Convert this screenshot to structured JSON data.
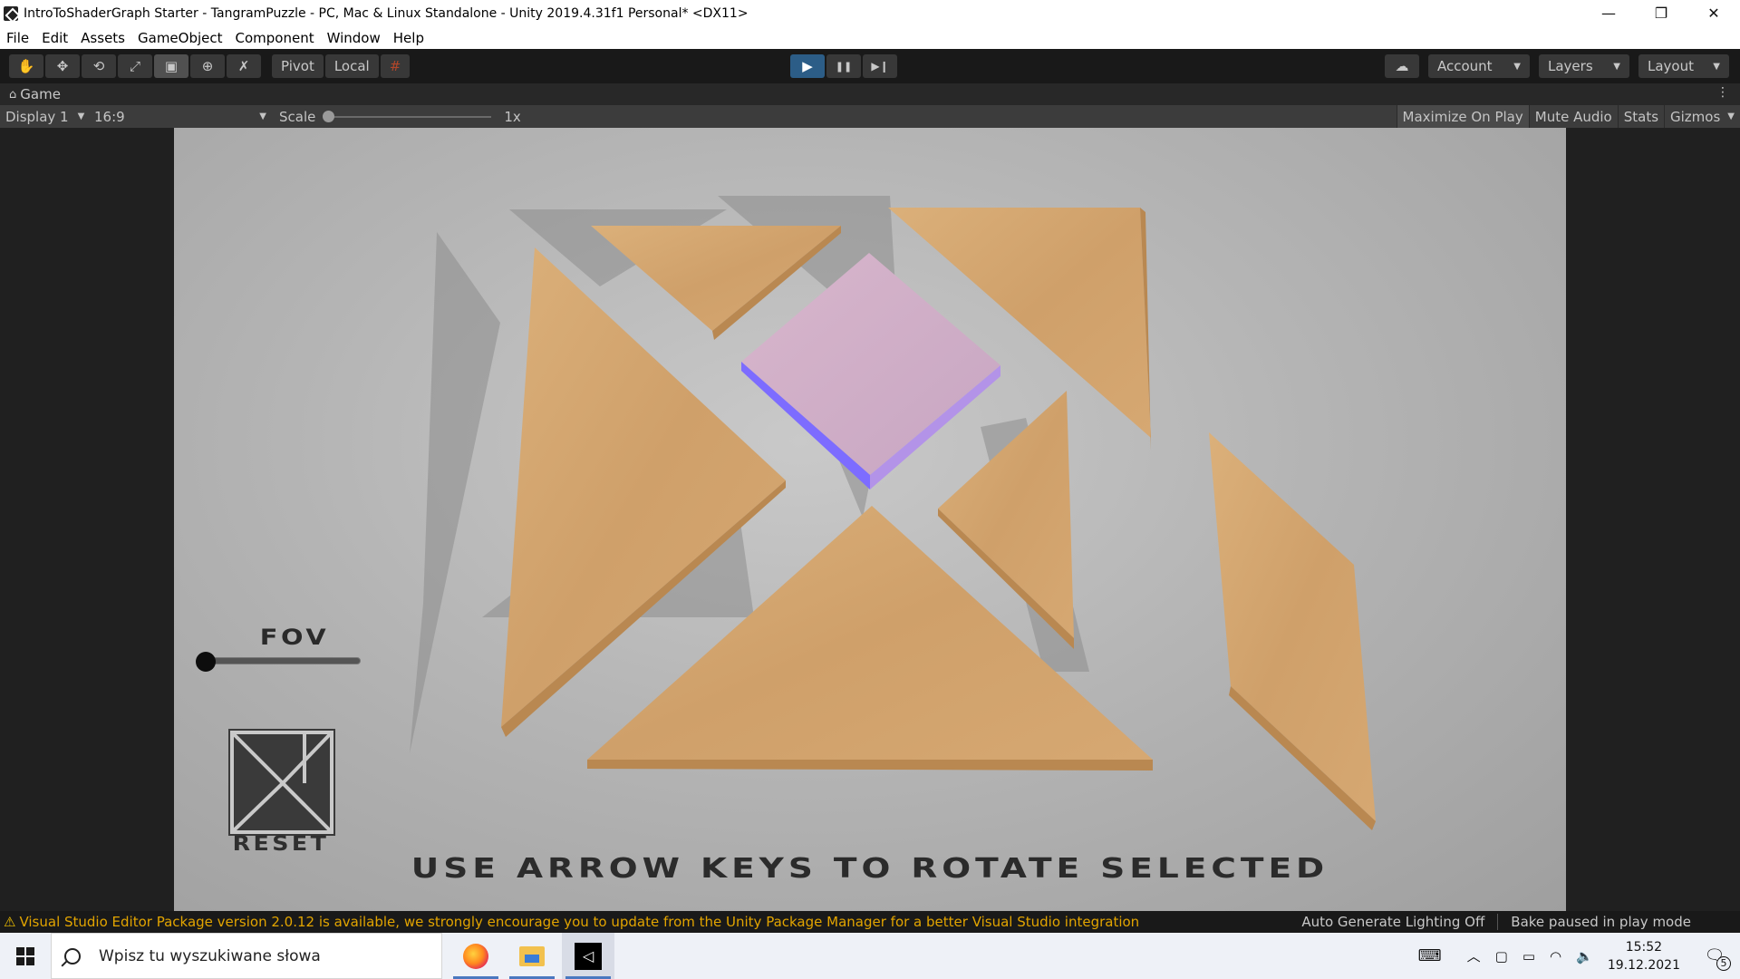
{
  "window": {
    "title": "IntroToShaderGraph Starter - TangramPuzzle - PC, Mac & Linux Standalone - Unity 2019.4.31f1 Personal* <DX11>",
    "controls": {
      "minimize": "—",
      "restore": "❐",
      "close": "✕"
    }
  },
  "menu": {
    "items": [
      "File",
      "Edit",
      "Assets",
      "GameObject",
      "Component",
      "Window",
      "Help"
    ]
  },
  "toolbar": {
    "tools": [
      {
        "name": "hand-tool",
        "glyph": "✋"
      },
      {
        "name": "move-tool",
        "glyph": "✥"
      },
      {
        "name": "rotate-tool",
        "glyph": "⟲"
      },
      {
        "name": "scale-tool",
        "glyph": "⤢"
      },
      {
        "name": "rect-tool",
        "glyph": "▣"
      },
      {
        "name": "transform-tool",
        "glyph": "⊕"
      },
      {
        "name": "custom-tool",
        "glyph": "✗"
      }
    ],
    "pivot_label": "Pivot",
    "local_label": "Local",
    "grid_snap_glyph": "#",
    "play_glyph": "▶",
    "pause_glyph": "❚❚",
    "step_glyph": "▶❙",
    "account_label": "Account",
    "layers_label": "Layers",
    "layout_label": "Layout",
    "cloud_glyph": "☁",
    "caret": "▼"
  },
  "tab": {
    "label": "Game",
    "icon": "gamepad-icon",
    "kebab": "⋮"
  },
  "gamebar": {
    "display_label": "Display 1",
    "aspect_label": "16:9",
    "scale_label": "Scale",
    "scale_value": "1x",
    "scale_slider": 0.0,
    "buttons": [
      "Maximize On Play",
      "Mute Audio",
      "Stats",
      "Gizmos"
    ],
    "gizmos_caret": "▼"
  },
  "game": {
    "fov_label": "FOV",
    "fov_value": 0.0,
    "reset_label": "RESET",
    "hint": "USE ARROW KEYS TO ROTATE SELECTED",
    "selected_color": "#c8a0c8",
    "wood_color": "#d2a46a"
  },
  "status": {
    "warning": "Visual Studio Editor Package version 2.0.12 is available, we strongly encourage you to update from the Unity Package Manager for a better Visual Studio integration",
    "lighting": "Auto Generate Lighting Off",
    "bake": "Bake paused in play mode",
    "warning_color": "#e2a400"
  },
  "taskbar": {
    "search_placeholder": "Wpisz tu wyszukiwane słowa",
    "time": "15:52",
    "date": "19.12.2021",
    "notifications": "5",
    "tray_icons": [
      "keyboard-icon",
      "chevron-up-icon",
      "meet-icon",
      "battery-icon",
      "wifi-icon",
      "volume-icon"
    ]
  }
}
